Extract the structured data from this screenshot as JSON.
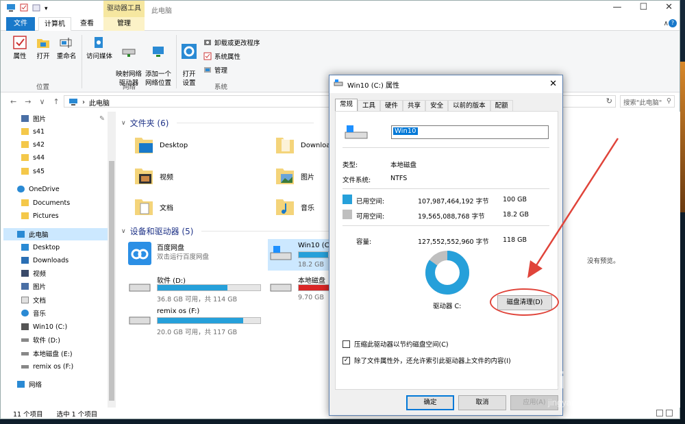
{
  "explorer": {
    "title": "此电脑",
    "context_tab": "驱动器工具",
    "tabs": {
      "file": "文件",
      "computer": "计算机",
      "view": "查看",
      "manage": "管理"
    },
    "ribbon": {
      "properties": "属性",
      "open": "打开",
      "rename": "重命名",
      "access_media": "访问媒体",
      "map_drive": "映射网络\n驱动器",
      "add_location": "添加一个\n网络位置",
      "open_settings": "打开\n设置",
      "uninstall": "卸载或更改程序",
      "system_props": "系统属性",
      "manage": "管理",
      "group_location": "位置",
      "group_network": "网络",
      "group_system": "系统"
    },
    "address": {
      "path": "此电脑",
      "search_placeholder": "搜索\"此电脑\""
    },
    "nav": {
      "items": [
        {
          "label": "图片",
          "pinned": true
        },
        {
          "label": "s41"
        },
        {
          "label": "s42"
        },
        {
          "label": "s44"
        },
        {
          "label": "s45"
        },
        {
          "label": "OneDrive"
        },
        {
          "label": "Documents"
        },
        {
          "label": "Pictures"
        },
        {
          "label": "此电脑"
        },
        {
          "label": "Desktop"
        },
        {
          "label": "Downloads"
        },
        {
          "label": "视频"
        },
        {
          "label": "图片"
        },
        {
          "label": "文档"
        },
        {
          "label": "音乐"
        },
        {
          "label": "Win10 (C:)"
        },
        {
          "label": "软件 (D:)"
        },
        {
          "label": "本地磁盘 (E:)"
        },
        {
          "label": "remix os (F:)"
        },
        {
          "label": "网络"
        }
      ]
    },
    "folders_header": "文件夹 (6)",
    "folders": [
      "Desktop",
      "Download",
      "视频",
      "图片",
      "文档",
      "音乐"
    ],
    "drives_header": "设备和驱动器 (5)",
    "drives": [
      {
        "name": "百度网盘",
        "info": "双击运行百度网盘",
        "fill_pct": null
      },
      {
        "name": "Win10 (C:",
        "info": "18.2 GB",
        "fill_pct": 0.85
      },
      {
        "name": "软件 (D:)",
        "info": "36.8 GB 可用，共 114 GB",
        "fill_pct": 0.68
      },
      {
        "name": "本地磁盘",
        "info": "9.70 GB",
        "fill_pct": 0.9
      },
      {
        "name": "remix os (F:)",
        "info": "20.0 GB 可用，共 117 GB",
        "fill_pct": 0.83
      }
    ],
    "no_preview": "没有预览。",
    "status": {
      "count": "11 个项目",
      "selected": "选中 1 个项目"
    }
  },
  "dialog": {
    "title": "Win10 (C:) 属性",
    "tabs": [
      "常规",
      "工具",
      "硬件",
      "共享",
      "安全",
      "以前的版本",
      "配额"
    ],
    "name_value": "Win10",
    "type_label": "类型:",
    "type_value": "本地磁盘",
    "fs_label": "文件系统:",
    "fs_value": "NTFS",
    "used_label": "已用空间:",
    "used_bytes": "107,987,464,192 字节",
    "used_gb": "100 GB",
    "free_label": "可用空间:",
    "free_bytes": "19,565,088,768 字节",
    "free_gb": "18.2 GB",
    "cap_label": "容量:",
    "cap_bytes": "127,552,552,960 字节",
    "cap_gb": "118 GB",
    "drive_label": "驱动器 C:",
    "cleanup_button": "磁盘清理(D)",
    "compress_label": "压缩此驱动器以节约磁盘空间(C)",
    "index_label": "除了文件属性外，还允许索引此驱动器上文件的内容(I)",
    "ok": "确定",
    "cancel": "取消",
    "apply": "应用(A)",
    "used_fraction": 0.847,
    "colors": {
      "used": "#26a0da",
      "free": "#bfbfbf",
      "accent": "#0078d7"
    }
  },
  "watermark": {
    "text": "Bai 经验",
    "sub": "jingyan.baidu.com"
  }
}
